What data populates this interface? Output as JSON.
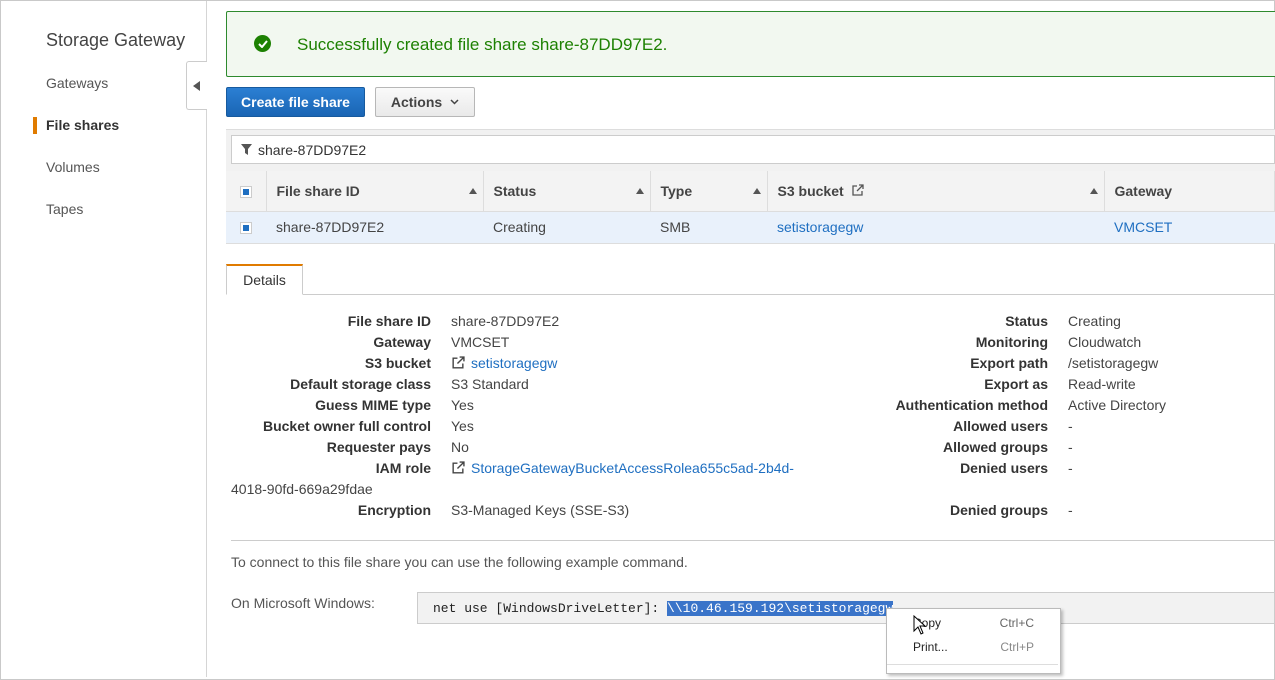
{
  "sidebar": {
    "title": "Storage Gateway",
    "items": [
      {
        "label": "Gateways"
      },
      {
        "label": "File shares"
      },
      {
        "label": "Volumes"
      },
      {
        "label": "Tapes"
      }
    ]
  },
  "alert": {
    "message": "Successfully created file share share-87DD97E2."
  },
  "toolbar": {
    "create_label": "Create file share",
    "actions_label": "Actions"
  },
  "filter": {
    "value": "share-87DD97E2"
  },
  "table": {
    "headers": [
      "File share ID",
      "Status",
      "Type",
      "S3 bucket",
      "Gateway"
    ],
    "rows": [
      {
        "id": "share-87DD97E2",
        "status": "Creating",
        "type": "SMB",
        "bucket": "setistoragegw",
        "gateway": "VMCSET"
      }
    ]
  },
  "details": {
    "tab_label": "Details",
    "left": [
      {
        "label": "File share ID",
        "value": "share-87DD97E2"
      },
      {
        "label": "Gateway",
        "value": "VMCSET"
      },
      {
        "label": "S3 bucket",
        "value": "setistoragegw"
      },
      {
        "label": "Default storage class",
        "value": "S3 Standard"
      },
      {
        "label": "Guess MIME type",
        "value": "Yes"
      },
      {
        "label": "Bucket owner full control",
        "value": "Yes"
      },
      {
        "label": "Requester pays",
        "value": "No"
      },
      {
        "label": "IAM role",
        "value": "StorageGatewayBucketAccessRolea655c5ad-2b4d-",
        "value_cont": "4018-90fd-669a29fdae"
      },
      {
        "label": "Encryption",
        "value": "S3-Managed Keys (SSE-S3)"
      }
    ],
    "right": [
      {
        "label": "Status",
        "value": "Creating"
      },
      {
        "label": "Monitoring",
        "value": "Cloudwatch"
      },
      {
        "label": "Export path",
        "value": "/setistoragegw"
      },
      {
        "label": "Export as",
        "value": "Read-write"
      },
      {
        "label": "Authentication method",
        "value": "Active Directory"
      },
      {
        "label": "Allowed users",
        "value": "-"
      },
      {
        "label": "Allowed groups",
        "value": "-"
      },
      {
        "label": "Denied users",
        "value": "-"
      },
      {
        "label": "Denied groups",
        "value": "-"
      }
    ]
  },
  "connect": {
    "help_text": "To connect to this file share you can use the following example command.",
    "windows_label": "On Microsoft Windows:",
    "cmd_prefix": "net use [WindowsDriveLetter]: ",
    "cmd_selected": "\\\\10.46.159.192\\setistoragegw"
  },
  "context_menu": {
    "items": [
      {
        "label": "Copy",
        "shortcut": "Ctrl+C"
      },
      {
        "label": "Print...",
        "shortcut": "Ctrl+P"
      }
    ]
  },
  "colors": {
    "accent": "#1f6fc1",
    "success": "#1d8102",
    "active_marker": "#e07b00"
  }
}
